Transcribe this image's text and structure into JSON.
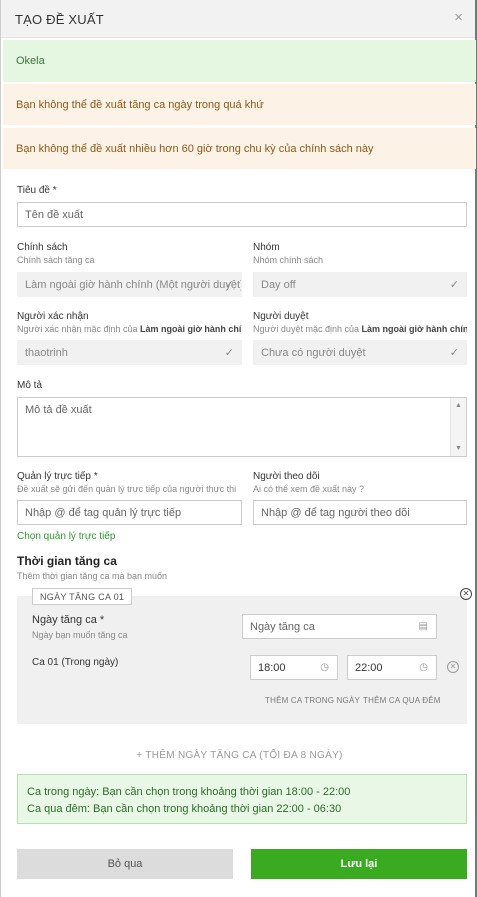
{
  "header": {
    "title": "TẠO ĐỀ XUẤT",
    "close_icon": "×"
  },
  "alerts": {
    "success": "Okela",
    "warn1": "Bạn không thể đề xuất tăng ca ngày trong quá khứ",
    "warn2": "Bạn không thể đề xuất nhiều hơn 60 giờ trong chu kỳ của chính sách này"
  },
  "title_field": {
    "label": "Tiêu đề *",
    "placeholder": "Tên đề xuất"
  },
  "policy": {
    "label": "Chính sách",
    "sub": "Chính sách tăng ca",
    "value": "Làm ngoài giờ hành chính (Một người duyệt)"
  },
  "group": {
    "label": "Nhóm",
    "sub": "Nhóm chính sách",
    "value": "Day off"
  },
  "confirmer": {
    "label": "Người xác nhận",
    "sub_prefix": "Người xác nhận mặc định của ",
    "sub_bold": "Làm ngoài giờ hành chí...",
    "value": "thaotrinh"
  },
  "approver": {
    "label": "Người duyệt",
    "sub_prefix": "Người duyệt mặc định của ",
    "sub_bold": "Làm ngoài giờ hành chính",
    "value": "Chưa có người duyệt"
  },
  "description": {
    "label": "Mô tả",
    "placeholder": "Mô tả đề xuất"
  },
  "manager": {
    "label": "Quản lý trực tiếp *",
    "sub": "Đề xuất sẽ gửi đến quản lý trực tiếp của người thực thi",
    "placeholder": "Nhập @ để tag quản lý trực tiếp",
    "link": "Chọn quản lý trực tiếp"
  },
  "follower": {
    "label": "Người theo dõi",
    "sub": "Ai có thể xem đề xuất này ?",
    "placeholder": "Nhập @ để tag người theo dõi"
  },
  "overtime": {
    "title": "Thời gian tăng ca",
    "sub": "Thêm thời gian tăng ca mà bạn muốn",
    "day_tag": "NGÀY TĂNG CA 01",
    "date_label": "Ngày tăng ca *",
    "date_sub": "Ngày bạn muốn tăng ca",
    "date_placeholder": "Ngày tăng ca",
    "shift_label": "Ca 01 (Trong ngày)",
    "start": "18:00",
    "end": "22:00",
    "add_in_day": "THÊM CA TRONG NGÀY",
    "add_overnight": "THÊM CA QUA ĐÊM",
    "add_day": "+ THÊM NGÀY TĂNG CA (TỐI ĐA 8 NGÀY)"
  },
  "info": {
    "line1": "Ca trong ngày: Bạn cần chọn trong khoảng thời gian 18:00 - 22:00",
    "line2": "Ca qua đêm: Bạn cần chọn trong khoảng thời gian 22:00 - 06:30"
  },
  "footer": {
    "cancel": "Bỏ qua",
    "save": "Lưu lại"
  },
  "icons": {
    "check": "check-icon",
    "calendar": "calendar-icon",
    "clock": "clock-icon",
    "close": "close-circle-icon"
  }
}
